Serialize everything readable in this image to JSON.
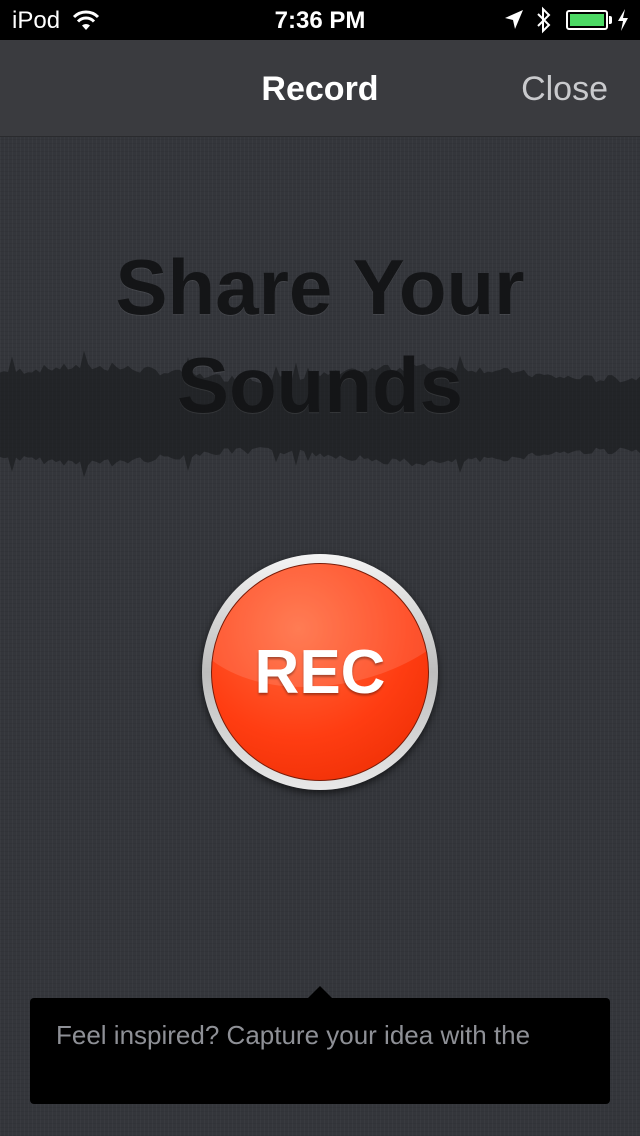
{
  "status_bar": {
    "carrier": "iPod",
    "time": "7:36 PM",
    "battery_color": "#4cd964"
  },
  "nav": {
    "title": "Record",
    "close_label": "Close"
  },
  "main": {
    "headline_line1": "Share Your",
    "headline_line2": "Sounds",
    "rec_label": "REC",
    "rec_color": "#ff3d12"
  },
  "tooltip": {
    "text": "Feel inspired? Capture your idea with the"
  },
  "icons": [
    "wifi-icon",
    "location-arrow-icon",
    "bluetooth-icon",
    "battery-icon",
    "charging-bolt-icon"
  ]
}
